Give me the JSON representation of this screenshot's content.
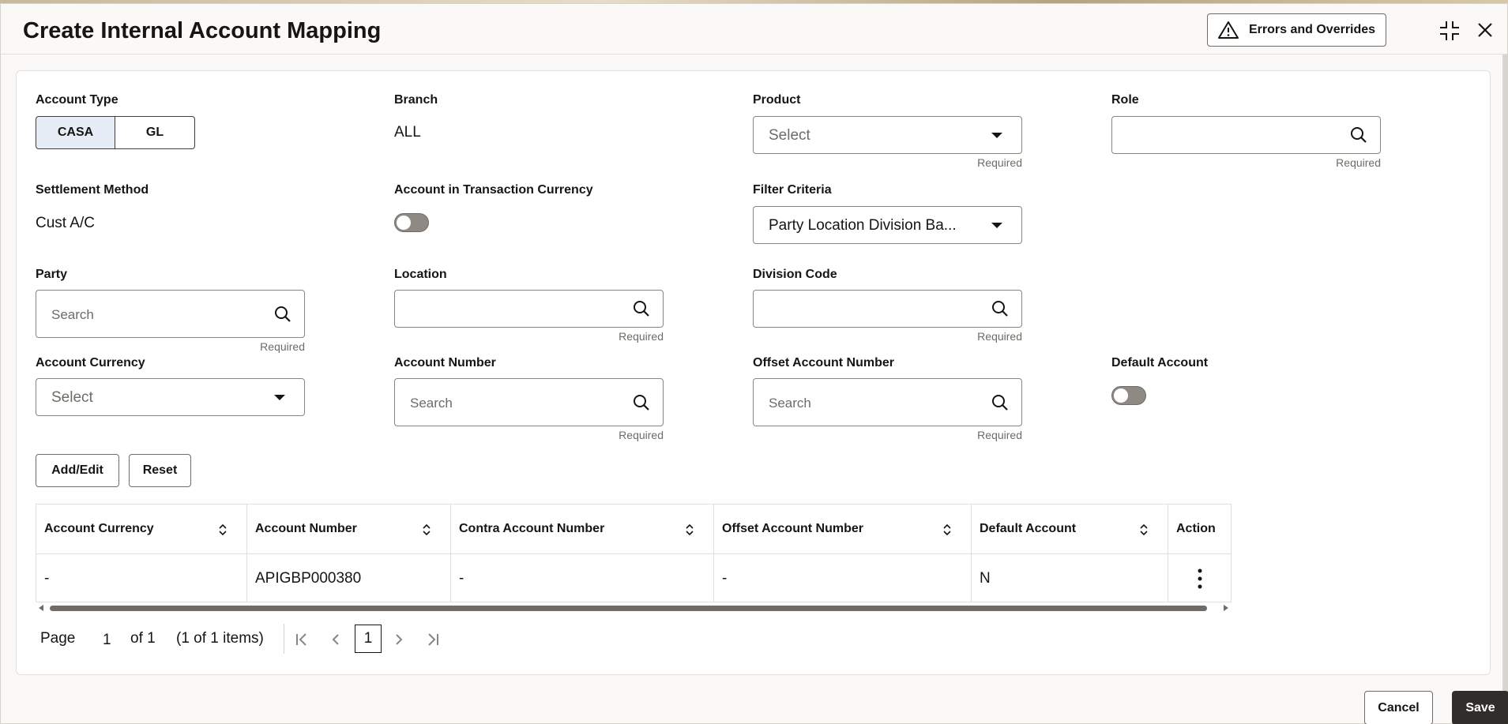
{
  "header": {
    "title": "Create Internal Account Mapping",
    "errors_label": "Errors and Overrides"
  },
  "form": {
    "account_type": {
      "label": "Account Type",
      "options": [
        "CASA",
        "GL"
      ],
      "selected": "CASA"
    },
    "branch": {
      "label": "Branch",
      "value": "ALL"
    },
    "product": {
      "label": "Product",
      "placeholder": "Select",
      "required": "Required"
    },
    "role": {
      "label": "Role",
      "value": "",
      "required": "Required"
    },
    "settlement_method": {
      "label": "Settlement Method",
      "value": "Cust A/C"
    },
    "account_in_txn_currency": {
      "label": "Account in Transaction Currency",
      "on": false
    },
    "filter_criteria": {
      "label": "Filter Criteria",
      "value": "Party Location Division Ba..."
    },
    "party": {
      "label": "Party",
      "placeholder": "Search",
      "required": "Required"
    },
    "location": {
      "label": "Location",
      "value": "",
      "required": "Required"
    },
    "division_code": {
      "label": "Division Code",
      "value": "",
      "required": "Required"
    },
    "account_currency": {
      "label": "Account Currency",
      "placeholder": "Select"
    },
    "account_number": {
      "label": "Account Number",
      "placeholder": "Search",
      "required": "Required"
    },
    "offset_account_number": {
      "label": "Offset Account Number",
      "placeholder": "Search",
      "required": "Required"
    },
    "default_account": {
      "label": "Default Account",
      "on": false
    }
  },
  "actions": {
    "add_edit": "Add/Edit",
    "reset": "Reset"
  },
  "table": {
    "columns": [
      "Account Currency",
      "Account Number",
      "Contra Account Number",
      "Offset Account Number",
      "Default Account",
      "Action"
    ],
    "rows": [
      [
        "-",
        "APIGBP000380",
        "-",
        "-",
        "N"
      ]
    ]
  },
  "pagination": {
    "page_label": "Page",
    "page": "1",
    "of_label": "of 1",
    "items_label": "(1 of 1 items)",
    "current": "1"
  },
  "footer": {
    "cancel": "Cancel",
    "save": "Save"
  },
  "colors": {
    "accent_selected": "#e6edf7",
    "primary_button": "#312d2a"
  }
}
